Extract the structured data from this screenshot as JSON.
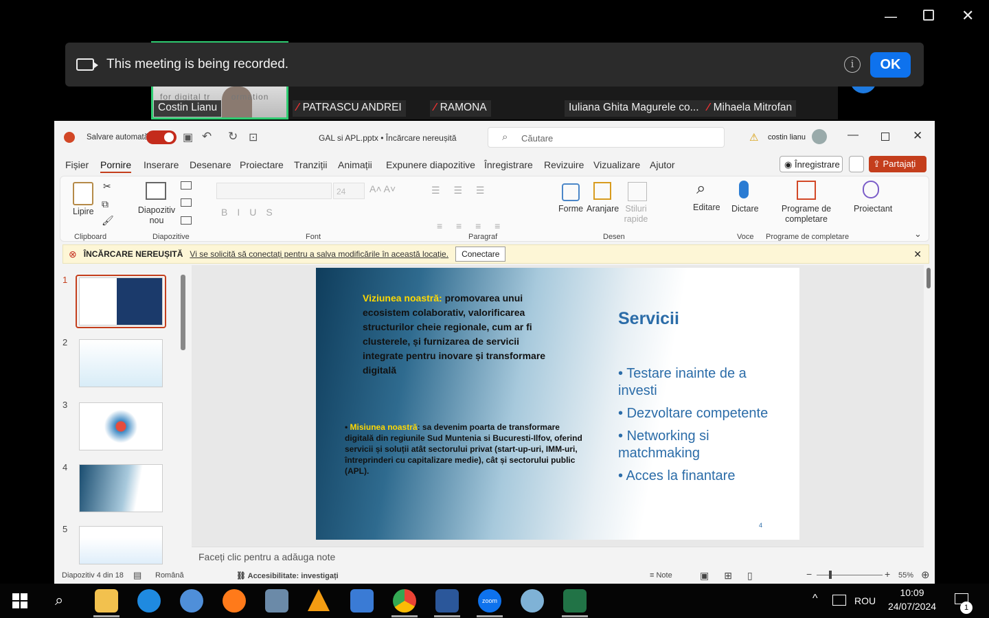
{
  "recording_banner": {
    "text": "This meeting is being recorded.",
    "ok": "OK",
    "info_icon": "i"
  },
  "participants": [
    "Costin Lianu",
    "PATRASCU ANDREI",
    "RAMONA",
    "Iuliana Ghita Magurele co...",
    "Mihaela Mitrofan"
  ],
  "camera_overlay_text": "for digital tr       ormation",
  "ppt": {
    "autosave": "Salvare automată",
    "file_title": "GAL si APL.pptx • Încărcare nereușită",
    "search_placeholder": "Căutare",
    "user": "costin lianu",
    "menu": [
      "Fișier",
      "Pornire",
      "Inserare",
      "Desenare",
      "Proiectare",
      "Tranziții",
      "Animații",
      "Expunere diapozitive",
      "Înregistrare",
      "Revizuire",
      "Vizualizare",
      "Ajutor"
    ],
    "record_btn": "Înregistrare",
    "share_btn": "Partajați",
    "ribbon": {
      "paste": "Lipire",
      "clipboard": "Clipboard",
      "new_slide": "Diapozitiv nou",
      "slides": "Diapozitive",
      "font_size": "24",
      "font": "Font",
      "paragraph": "Paragraf",
      "shapes": "Forme",
      "arrange": "Aranjare",
      "quick_styles": "Stiluri rapide",
      "drawing": "Desen",
      "editing": "Editare",
      "dictate": "Dictare",
      "voice": "Voce",
      "addins": "Programe de completare",
      "addins_group": "Programe de completare",
      "designer": "Proiectant"
    },
    "error": {
      "title": "ÎNCĂRCARE NEREUȘITĂ",
      "message": "Vi se solicită să conectați pentru a salva modificările în această locație.",
      "button": "Conectare"
    },
    "thumb_numbers": [
      "1",
      "2",
      "3",
      "4",
      "5"
    ],
    "slide": {
      "vision_label": "Viziunea noastră:",
      "vision_text": "promovarea unui ecosistem colaborativ, valorificarea structurilor cheie regionale, cum ar fi clusterele, și furnizarea de servicii integrate pentru inovare și transformare digitală",
      "mission_label": "Misiunea noastră",
      "mission_text": ": sa devenim poarta de transformare digitală din regiunile Sud Muntenia si Bucuresti-Ilfov, oferind servicii și soluții  atât sectorului privat (start-up-uri, IMM-uri, întreprinderi cu capitalizare medie), cât și sectorului public (APL).",
      "services_title": "Servicii",
      "services": [
        "Testare inainte de a investi",
        "Dezvoltare competente",
        "Networking si matchmaking",
        "Acces la finantare"
      ],
      "page_number": "4"
    },
    "notes_placeholder": "Faceți clic pentru a adăuga note",
    "status": {
      "slide_count": "Diapozitiv 4 din 18",
      "language": "Română",
      "accessibility": "Accesibilitate: investigați",
      "notes": "Note",
      "zoom": "55%"
    }
  },
  "taskbar": {
    "lang": "ROU",
    "time": "10:09",
    "date": "24/07/2024",
    "notif_count": "1",
    "zoom_label": "zoom"
  }
}
